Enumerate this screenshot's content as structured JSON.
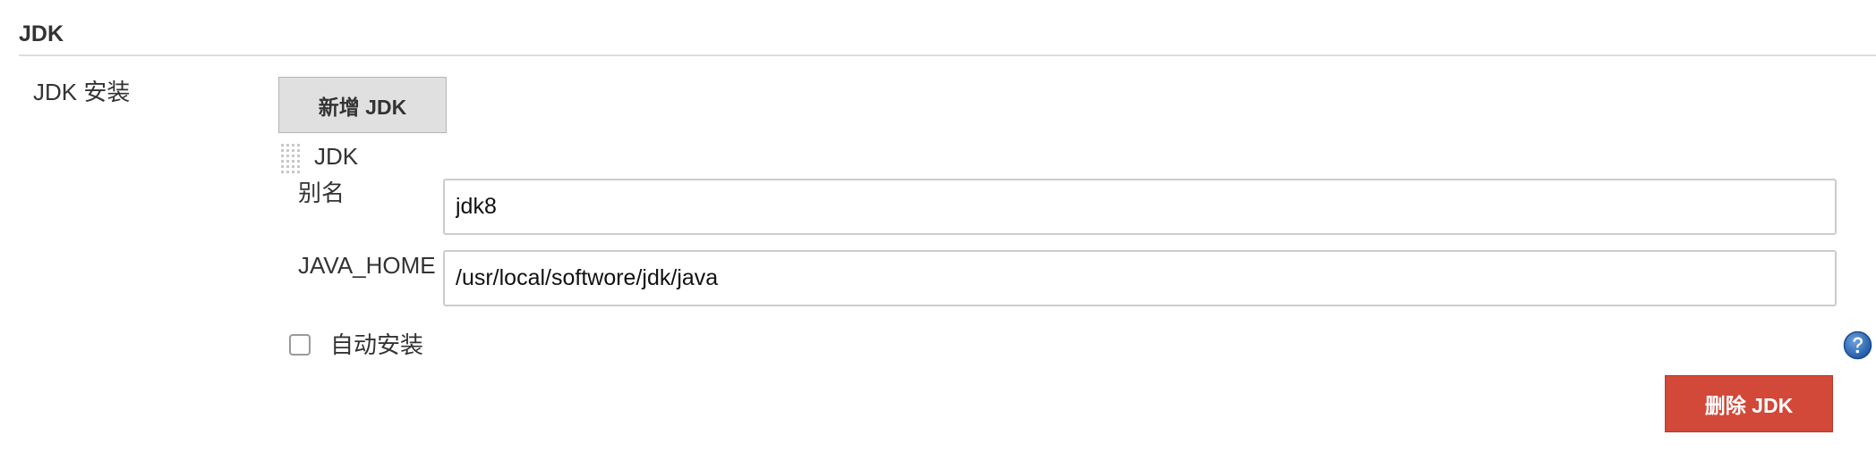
{
  "section": {
    "title": "JDK"
  },
  "jdk_installations": {
    "label": "JDK 安装",
    "add_button_label": "新增 JDK",
    "item": {
      "title": "JDK",
      "alias_label": "别名",
      "alias_value": "jdk8",
      "java_home_label": "JAVA_HOME",
      "java_home_value": "/usr/local/softwore/jdk/java",
      "auto_install_label": "自动安装",
      "auto_install_checked": false,
      "delete_button_label": "删除 JDK"
    }
  },
  "icons": {
    "drag_handle": "drag-handle-icon",
    "help": "help-icon"
  },
  "colors": {
    "delete_button": "#d24939",
    "add_button": "#e0e0e0",
    "help_icon": "#2b6cb0"
  }
}
